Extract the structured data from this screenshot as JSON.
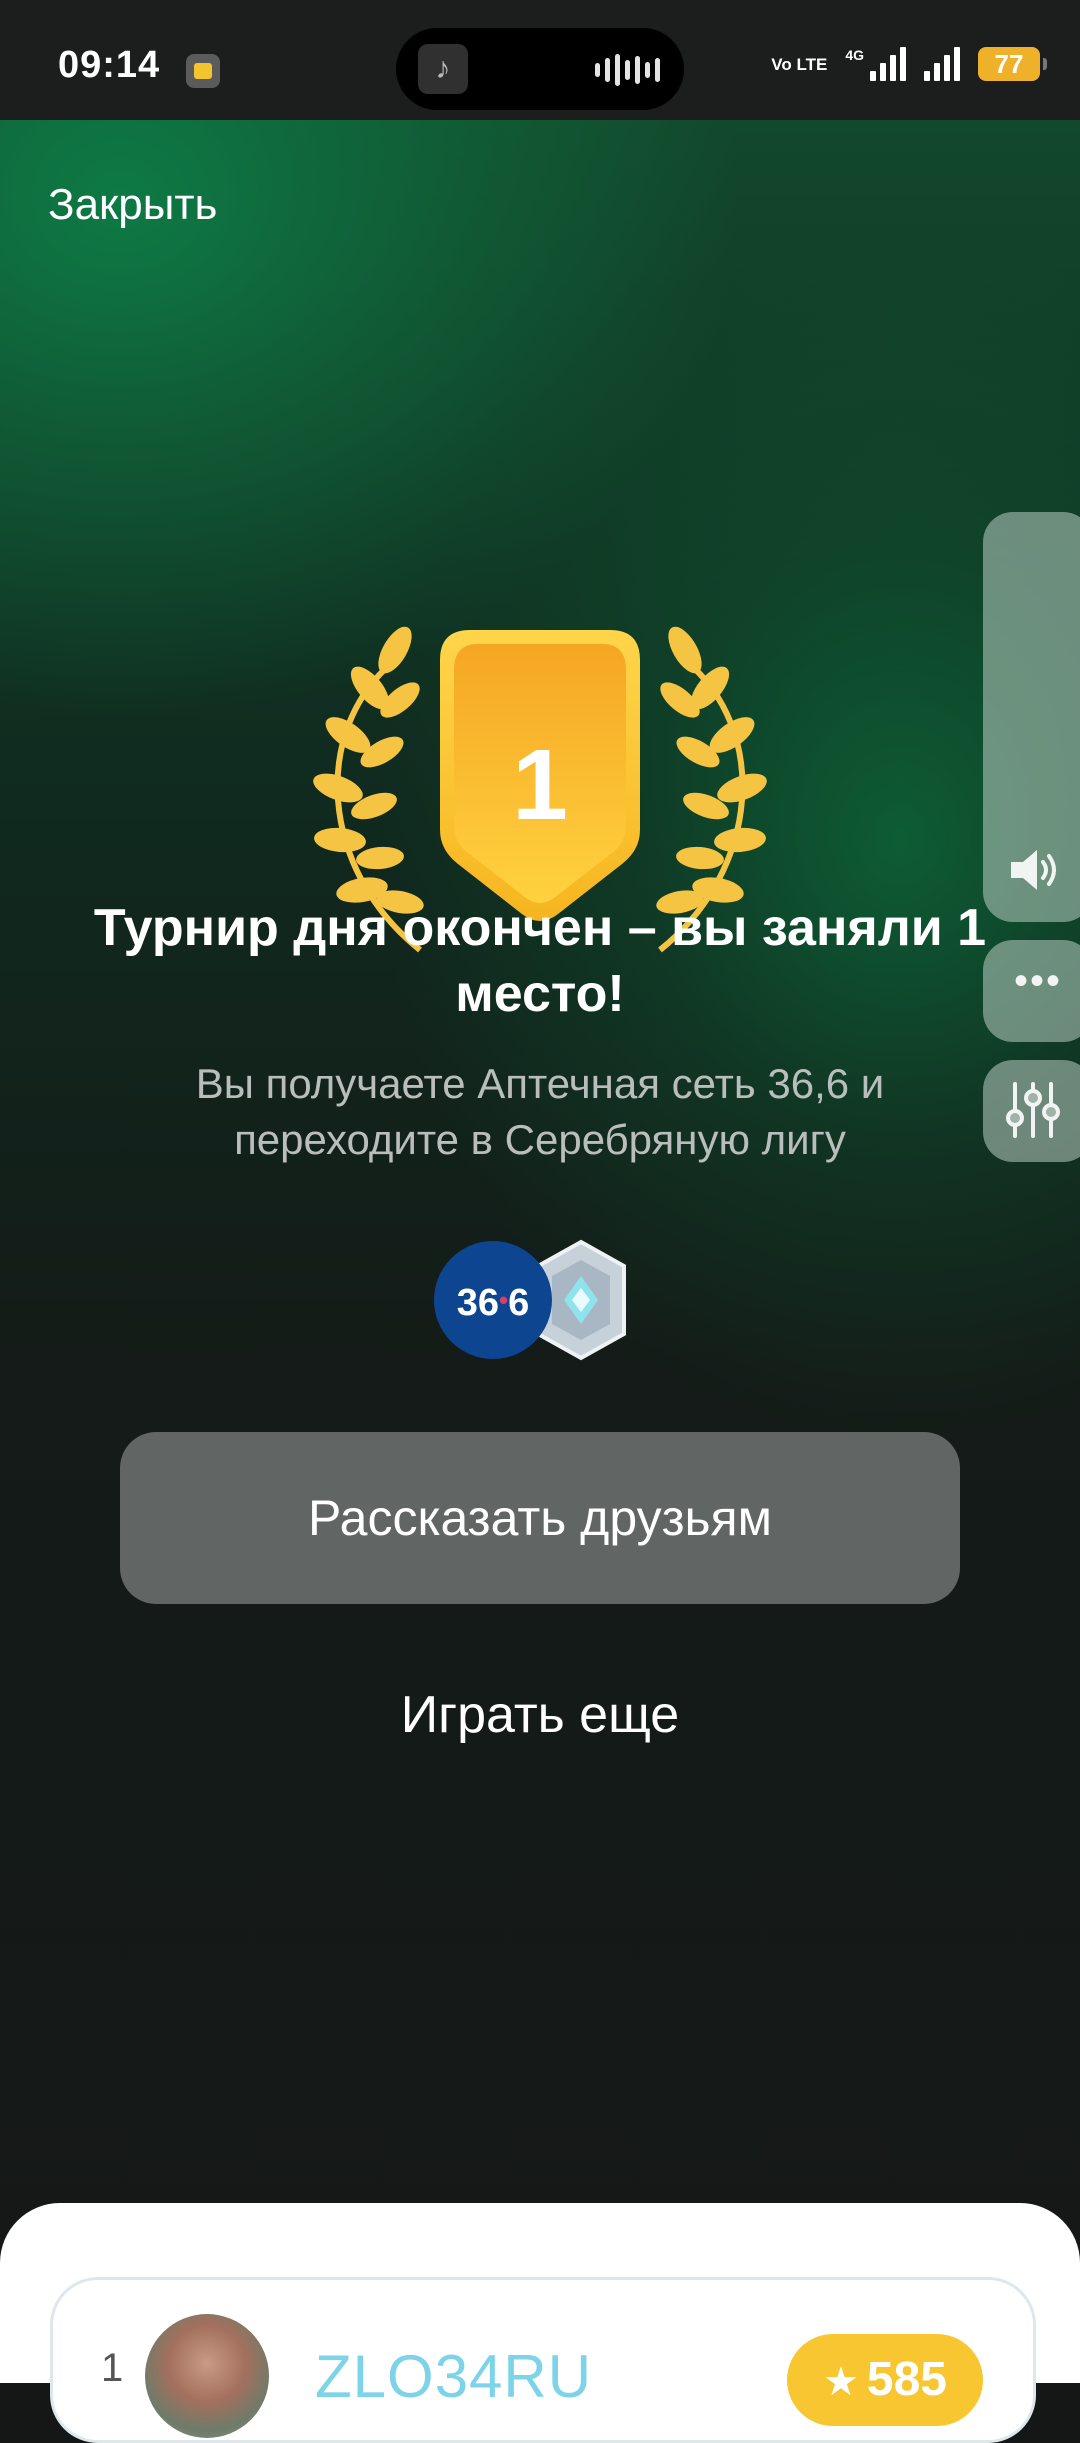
{
  "status_bar": {
    "time": "09:14",
    "network_volte": "Vo LTE",
    "network_gen": "4G",
    "battery": "77"
  },
  "header": {
    "close_label": "Закрыть"
  },
  "result": {
    "place": "1",
    "headline": "Турнир дня окончен – вы заняли 1 место!",
    "subline": "Вы получаете Аптечная сеть 36,6 и переходите в Серебряную лигу",
    "reward_badge": "36",
    "reward_badge_suffix": "6"
  },
  "actions": {
    "share_label": "Рассказать друзьям",
    "play_again_label": "Играть еще"
  },
  "side_panel": {
    "more_label": "•••"
  },
  "leaderboard": {
    "rows": [
      {
        "rank": "1",
        "name": "ZLO34RU",
        "score": "585"
      }
    ]
  },
  "colors": {
    "accent_gold": "#f8c630",
    "badge_blue": "#0d4591",
    "name_cyan": "#7dd3e8",
    "button_gray": "#616563"
  }
}
